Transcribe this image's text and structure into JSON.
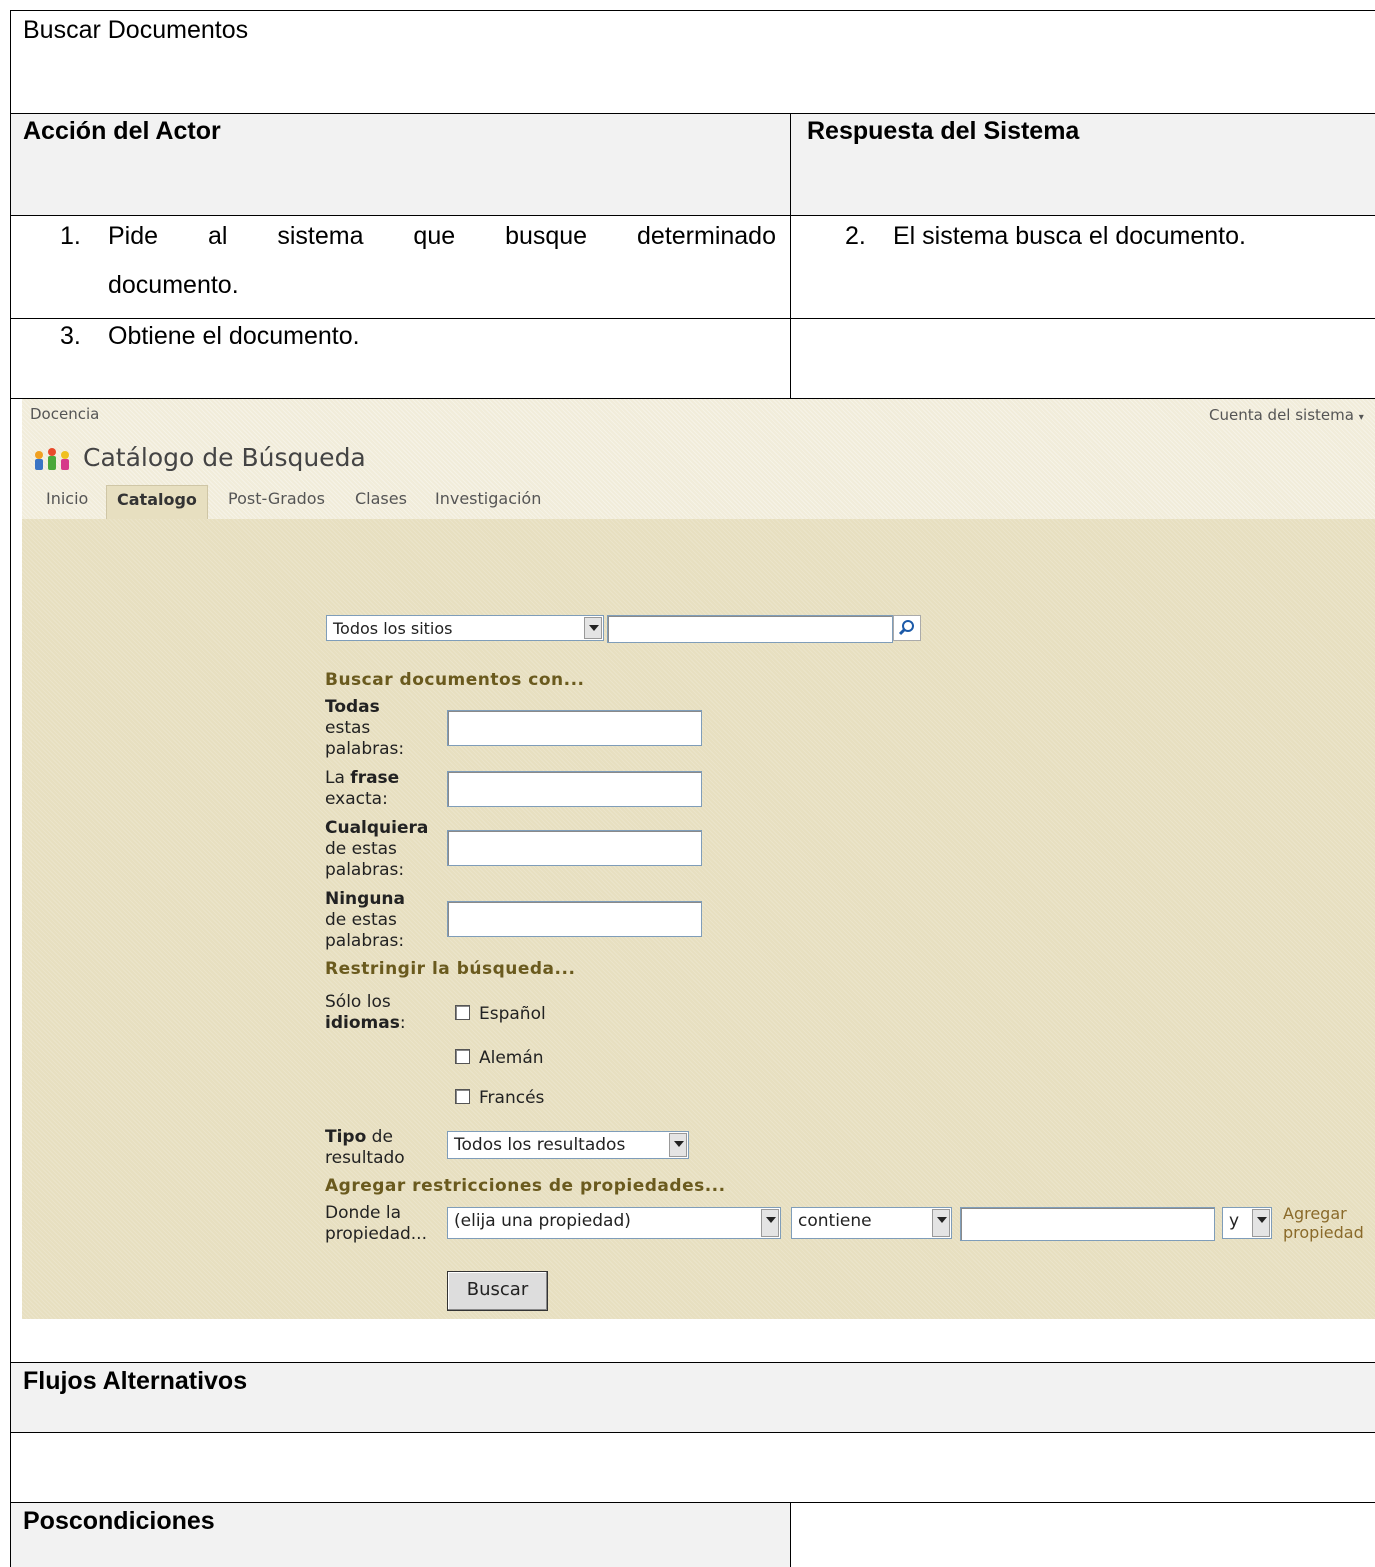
{
  "doc": {
    "title": "Buscar Documentos",
    "col_actor": "Acción del Actor",
    "col_system": "Respuesta del Sistema",
    "step1_num": "1.",
    "step1_line1": [
      "Pide",
      "al",
      "sistema",
      "que",
      "busque",
      "determinado"
    ],
    "step1_line2": "documento.",
    "step2_num": "2.",
    "step2_text": "El sistema busca el documento.",
    "step3_num": "3.",
    "step3_text": "Obtiene el documento.",
    "alt_flows": "Flujos Alternativos",
    "postconditions": "Poscondiciones"
  },
  "screen": {
    "site_name": "Docencia",
    "account": "Cuenta del sistema",
    "page_title": "Catálogo de Búsqueda",
    "tabs": [
      {
        "label": "Inicio",
        "selected": false
      },
      {
        "label": "Catalogo",
        "selected": true
      },
      {
        "label": "Post-Grados",
        "selected": false
      },
      {
        "label": "Clases",
        "selected": false
      },
      {
        "label": "Investigación",
        "selected": false
      }
    ],
    "scope_select": "Todos los sitios",
    "search_box_value": "",
    "find_docs_heading": "Buscar documentos con...",
    "all_words": {
      "bold": "Todas",
      "rest1": "estas",
      "rest2": "palabras:"
    },
    "exact_phrase": {
      "pre": "La ",
      "bold": "frase",
      "rest": "exacta:"
    },
    "any_words": {
      "bold": "Cualquiera",
      "rest1": "de estas",
      "rest2": "palabras:"
    },
    "none_words": {
      "bold": "Ninguna",
      "rest1": "de estas",
      "rest2": "palabras:"
    },
    "narrow_heading": "Restringir la búsqueda...",
    "languages_label": {
      "pre": "Sólo los",
      "bold": "idiomas",
      "post": ":"
    },
    "languages": [
      "Español",
      "Alemán",
      "Francés"
    ],
    "result_type_label": {
      "bold": "Tipo",
      "post": " de",
      "line2": "resultado"
    },
    "result_type_select": "Todos los resultados",
    "property_heading": "Agregar restricciones de propiedades...",
    "where_label": {
      "line1": "Donde la",
      "line2": "propiedad..."
    },
    "property_select": "(elija una propiedad)",
    "operator_select": "contiene",
    "conjunction_select": "y",
    "add_property": {
      "line1": "Agregar",
      "line2": "propiedad"
    },
    "search_button": "Buscar",
    "colors": {
      "panel": "#e7dfc0",
      "heading": "#6a5a1e",
      "tab_selected": "#333333"
    }
  }
}
